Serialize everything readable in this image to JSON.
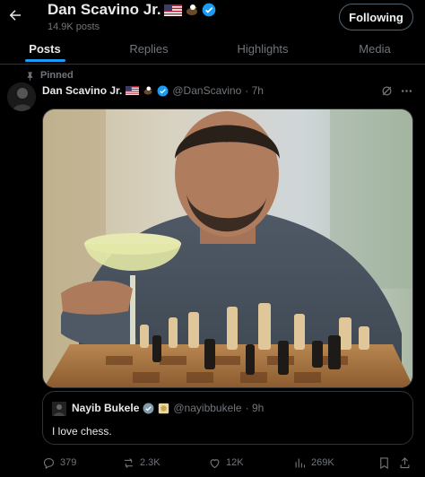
{
  "header": {
    "name": "Dan Scavino Jr.",
    "posts_count": "14.9K posts",
    "follow_label": "Following"
  },
  "tabs": [
    {
      "label": "Posts",
      "active": true
    },
    {
      "label": "Replies",
      "active": false
    },
    {
      "label": "Highlights",
      "active": false
    },
    {
      "label": "Media",
      "active": false
    }
  ],
  "post": {
    "pinned_label": "Pinned",
    "author": "Dan Scavino Jr.",
    "handle": "@DanScavino",
    "time": "· 7h",
    "quote": {
      "author": "Nayib Bukele",
      "handle": "@nayibbukele",
      "time": "· 9h",
      "text": "I love chess."
    },
    "stats": {
      "replies": "379",
      "reposts": "2.3K",
      "likes": "12K",
      "views": "269K"
    }
  },
  "colors": {
    "background": "#000000",
    "accent": "#1d9bf0",
    "muted": "#71767b",
    "verified": "#1d9bf0"
  }
}
